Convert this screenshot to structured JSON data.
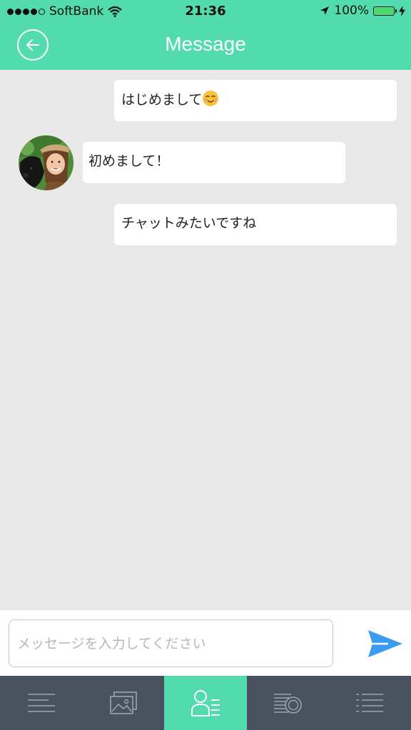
{
  "status_bar": {
    "carrier": "SoftBank",
    "time": "21:36",
    "battery": "100%",
    "battery_level": 1.0,
    "signal_bars": 4,
    "signal_max": 5
  },
  "header": {
    "title": "Message",
    "back_icon": "arrow-left-icon"
  },
  "messages": [
    {
      "sender": "self",
      "text": "はじめまして",
      "emoji": "smiling-face-icon"
    },
    {
      "sender": "other",
      "text": "初めまして！"
    },
    {
      "sender": "self",
      "text": "チャットみたいですね"
    }
  ],
  "composer": {
    "placeholder": "メッセージを入力してください",
    "value": "",
    "send_icon": "send-icon"
  },
  "tabbar": {
    "items": [
      {
        "icon": "menu-lines-icon",
        "active": false
      },
      {
        "icon": "gallery-icon",
        "active": false
      },
      {
        "icon": "profile-list-icon",
        "active": true
      },
      {
        "icon": "coins-icon",
        "active": false
      },
      {
        "icon": "list-icon",
        "active": false
      }
    ]
  },
  "colors": {
    "accent": "#52dcae",
    "tabbar": "#49535f",
    "send": "#3a9bf0",
    "chat_background": "#e9e9e9"
  }
}
